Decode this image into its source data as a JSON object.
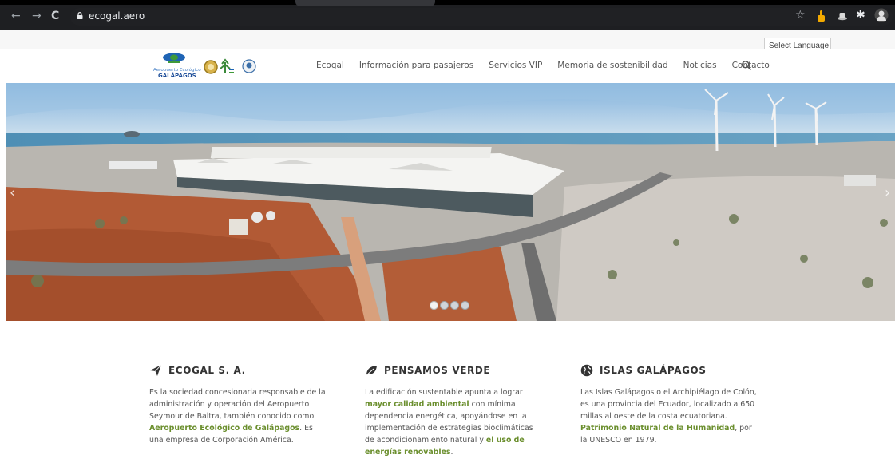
{
  "browser": {
    "url": "ecogal.aero",
    "icons": [
      "back-arrow-icon",
      "forward-arrow-icon",
      "reload-icon",
      "lock-icon",
      "star-icon",
      "thumbs-up-extension-icon",
      "hat-extension-icon",
      "puzzle-extensions-icon",
      "profile-avatar-icon"
    ],
    "glyphs": {
      "back": "←",
      "forward": "→",
      "reload": "C",
      "star": "☆",
      "puzzle": "✱"
    }
  },
  "language": {
    "label": "Select Language"
  },
  "logo": {
    "line1": "Aeropuerto Ecológico",
    "line2": "GALÁPAGOS"
  },
  "nav": {
    "items": [
      "Ecogal",
      "Información para pasajeros",
      "Servicios VIP",
      "Memoria de sostenibilidad",
      "Noticias",
      "Contacto"
    ]
  },
  "hero": {
    "slides": 4,
    "active_slide": 1,
    "prev": "‹",
    "next": "›"
  },
  "columns": [
    {
      "icon": "paper-plane-icon",
      "title": "ECOGAL S. A.",
      "t1": "Es la sociedad concesionaria responsable de la administración y operación del Aeropuerto Seymour de Baltra, también conocido como ",
      "b1": "Aeropuerto Ecológico de Galápagos",
      "t2": ". Es una empresa de Corporación América."
    },
    {
      "icon": "leaf-icon",
      "title": "PENSAMOS VERDE",
      "t1": "La edificación sustentable apunta a lograr ",
      "b1": "mayor calidad ambiental",
      "t2": " con mínima dependencia energética, apoyándose en la implementación de estrategias bioclimáticas de acondicionamiento natural y ",
      "b2": "el uso de energías renovables",
      "t3": "."
    },
    {
      "icon": "globe-icon",
      "title": "ISLAS GALÁPAGOS",
      "t1": "Las Islas Galápagos o el Archipiélago de Colón, es una provincia del Ecuador, localizado a 650 millas al oeste de la costa ecuatoriana. ",
      "b1": "Patrimonio Natural de la Humanidad",
      "t2": ", por la UNESCO en 1979."
    }
  ],
  "colors": {
    "accent_green": "#6b8f2e",
    "chrome_bg": "#1e1f22",
    "text": "#555555"
  }
}
